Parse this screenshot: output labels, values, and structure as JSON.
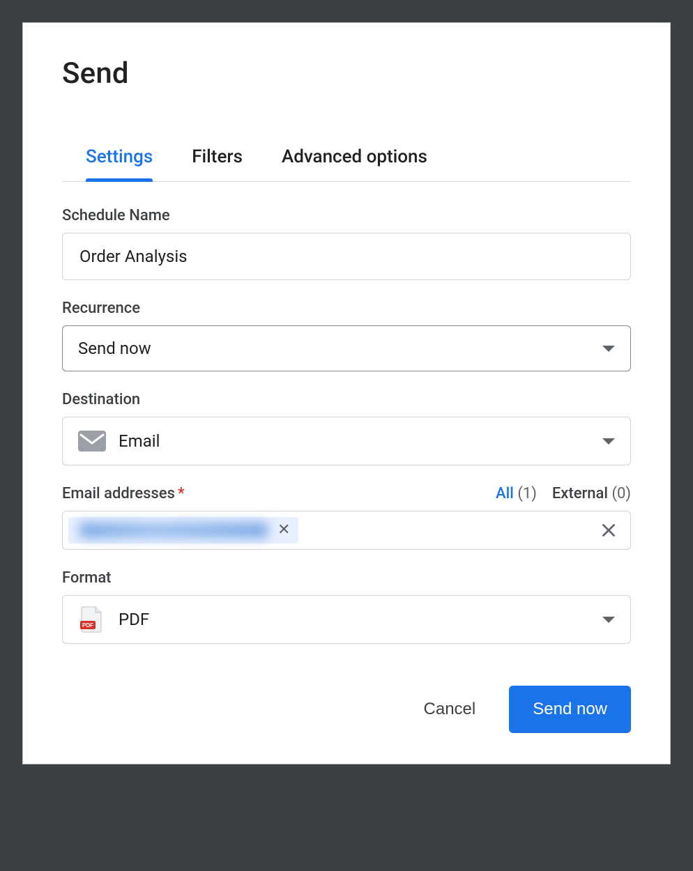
{
  "title": "Send",
  "tabs": {
    "settings": "Settings",
    "filters": "Filters",
    "advanced": "Advanced options"
  },
  "schedule": {
    "label": "Schedule Name",
    "value": "Order Analysis"
  },
  "recurrence": {
    "label": "Recurrence",
    "value": "Send now"
  },
  "destination": {
    "label": "Destination",
    "value": "Email"
  },
  "emails": {
    "label": "Email addresses",
    "required_marker": "*",
    "all_label": "All",
    "all_count": "(1)",
    "external_label": "External",
    "external_count": "(0)",
    "chip_remove_glyph": "✕"
  },
  "format": {
    "label": "Format",
    "value": "PDF"
  },
  "footer": {
    "cancel": "Cancel",
    "send_now": "Send now"
  }
}
